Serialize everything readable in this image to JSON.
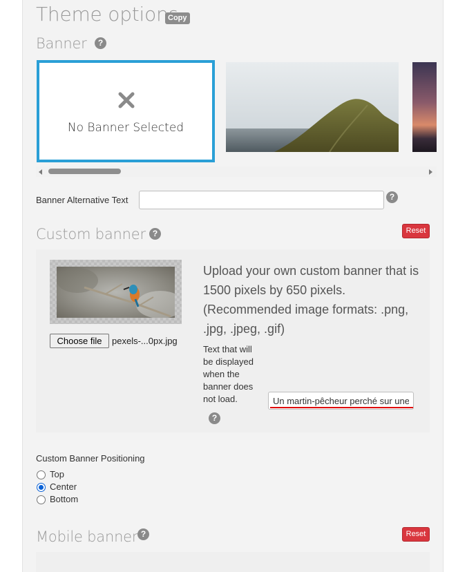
{
  "theme": {
    "title": "Theme options",
    "copy_badge": "Copy"
  },
  "banner": {
    "heading": "Banner",
    "no_banner_text": "No Banner Selected",
    "alt_label": "Banner Alternative Text",
    "alt_value": ""
  },
  "custom_banner": {
    "heading": "Custom banner",
    "reset_label": "Reset",
    "upload_info": "Upload your own custom banner that is 1500 pixels by 650 pixels. (Recommended image formats: .png, .jpg, .jpeg, .gif)",
    "choose_file_label": "Choose file",
    "file_name": "pexels-...0px.jpg",
    "alt_text_label": "Text that will be displayed when the banner does not load.",
    "alt_text_value": "Un martin-pêcheur perché sur une branche"
  },
  "positioning": {
    "label": "Custom Banner Positioning",
    "options": [
      "Top",
      "Center",
      "Bottom"
    ],
    "selected": "Center"
  },
  "mobile_banner": {
    "heading": "Mobile banner",
    "reset_label": "Reset"
  },
  "colors": {
    "accent_border": "#2a9fd6",
    "reset_red": "#d9363e",
    "radio_blue": "#0b62d6",
    "spellcheck_red": "#e00000"
  }
}
